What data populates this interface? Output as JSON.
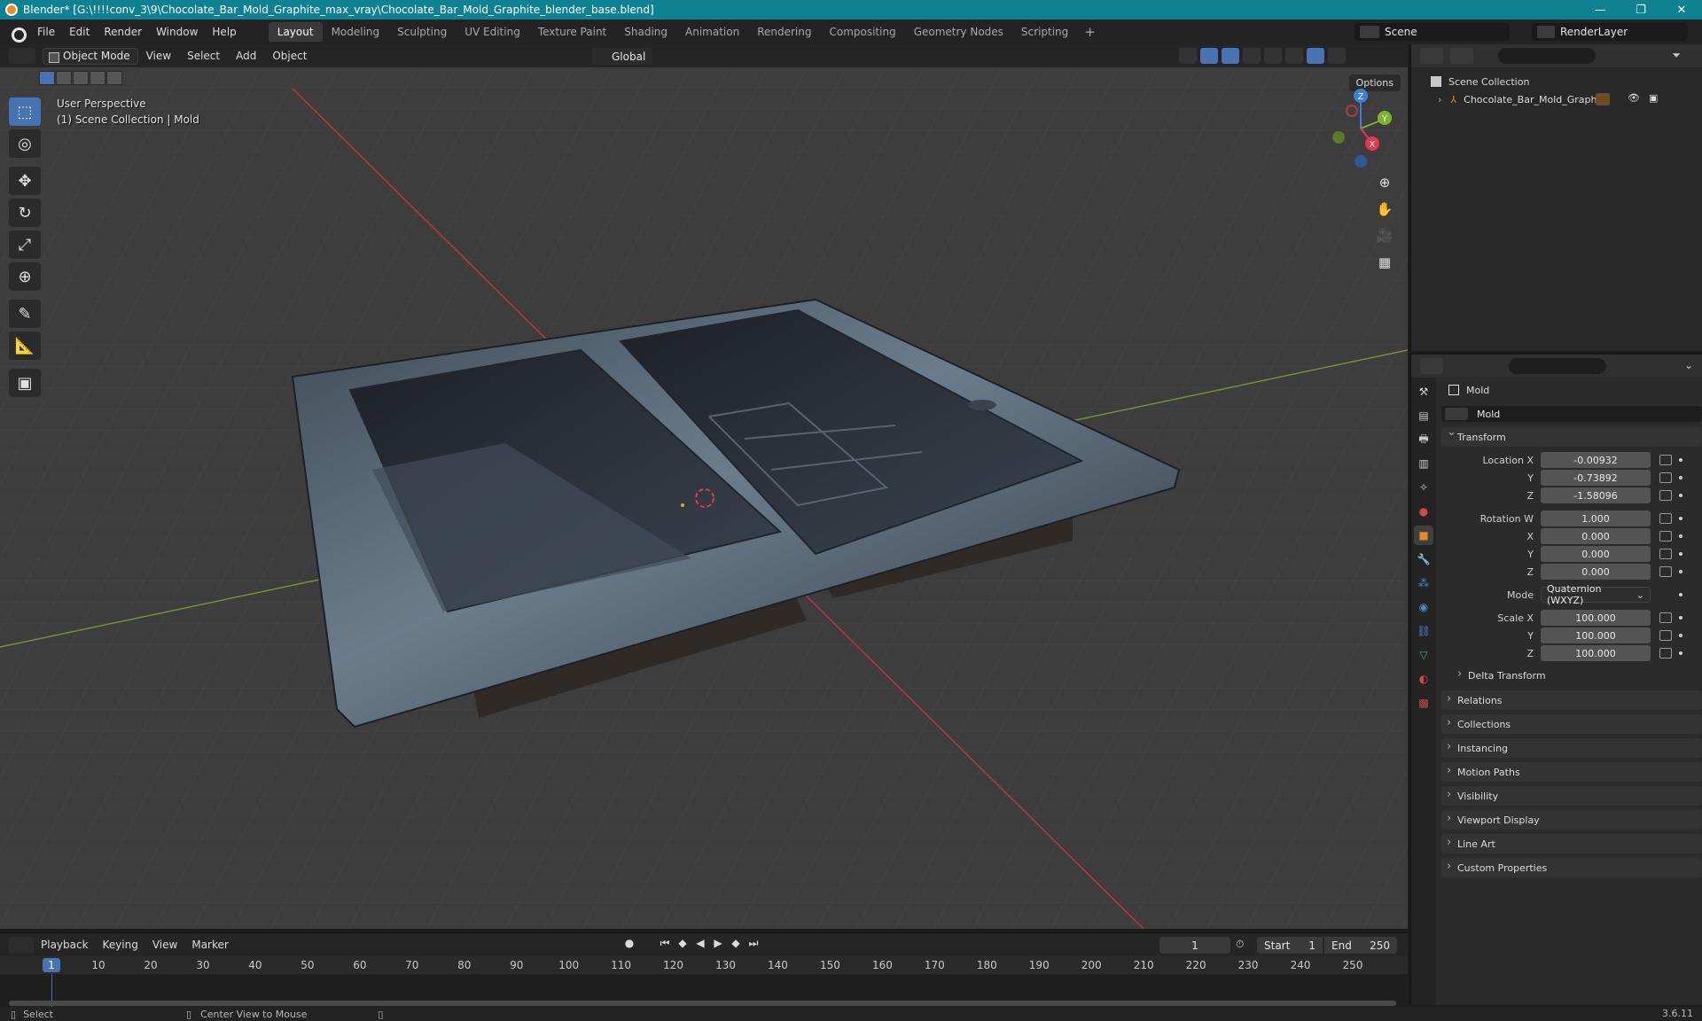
{
  "titlebar": {
    "title": "Blender* [G:\\!!!!conv_3\\9\\Chocolate_Bar_Mold_Graphite_max_vray\\Chocolate_Bar_Mold_Graphite_blender_base.blend]",
    "minimize": "—",
    "maximize": "❐",
    "close": "✕"
  },
  "menubar": {
    "items": [
      "File",
      "Edit",
      "Render",
      "Window",
      "Help"
    ],
    "workspaces": [
      "Layout",
      "Modeling",
      "Sculpting",
      "UV Editing",
      "Texture Paint",
      "Shading",
      "Animation",
      "Rendering",
      "Compositing",
      "Geometry Nodes",
      "Scripting"
    ],
    "active_workspace": "Layout",
    "add_workspace": "+",
    "scene": "Scene",
    "render_layer": "RenderLayer"
  },
  "viewport": {
    "mode": "Object Mode",
    "menus": [
      "View",
      "Select",
      "Add",
      "Object"
    ],
    "orientation": "Global",
    "options": "Options",
    "info_line1": "User Perspective",
    "info_line2": "(1) Scene Collection | Mold",
    "gizmo_axes": [
      "X",
      "Y",
      "Z"
    ],
    "axis_colors": {
      "x": "#e4394c",
      "y": "#7fb32c",
      "z": "#3c7fd6"
    },
    "accent": "#4772b3"
  },
  "timeline": {
    "menus": [
      "Playback",
      "Keying",
      "View",
      "Marker"
    ],
    "current_frame": "1",
    "start_label": "Start",
    "start": "1",
    "end_label": "End",
    "end": "250",
    "ruler": [
      "1",
      "10",
      "20",
      "30",
      "40",
      "50",
      "60",
      "70",
      "80",
      "90",
      "100",
      "110",
      "120",
      "130",
      "140",
      "150",
      "160",
      "170",
      "180",
      "190",
      "200",
      "210",
      "220",
      "230",
      "240",
      "250"
    ]
  },
  "statusbar": {
    "select": "Select",
    "center": "Center View to Mouse",
    "version": "3.6.11"
  },
  "outliner": {
    "root": "Scene Collection",
    "object": "Chocolate_Bar_Mold_Graphite"
  },
  "properties": {
    "context": "Mold",
    "object_name": "Mold",
    "transform_title": "Transform",
    "location_label": "Location X",
    "location": [
      "-0.00932",
      "-0.73892",
      "-1.58096"
    ],
    "rotation_label": "Rotation W",
    "rotation": [
      "1.000",
      "0.000",
      "0.000",
      "0.000"
    ],
    "axis_labels": [
      "X",
      "Y",
      "Z"
    ],
    "mode_label": "Mode",
    "mode_value": "Quaternion (WXYZ)",
    "scale_label": "Scale X",
    "scale": [
      "100.000",
      "100.000",
      "100.000"
    ],
    "delta_transform": "Delta Transform",
    "panels": [
      "Relations",
      "Collections",
      "Instancing",
      "Motion Paths",
      "Visibility",
      "Viewport Display",
      "Line Art",
      "Custom Properties"
    ]
  }
}
